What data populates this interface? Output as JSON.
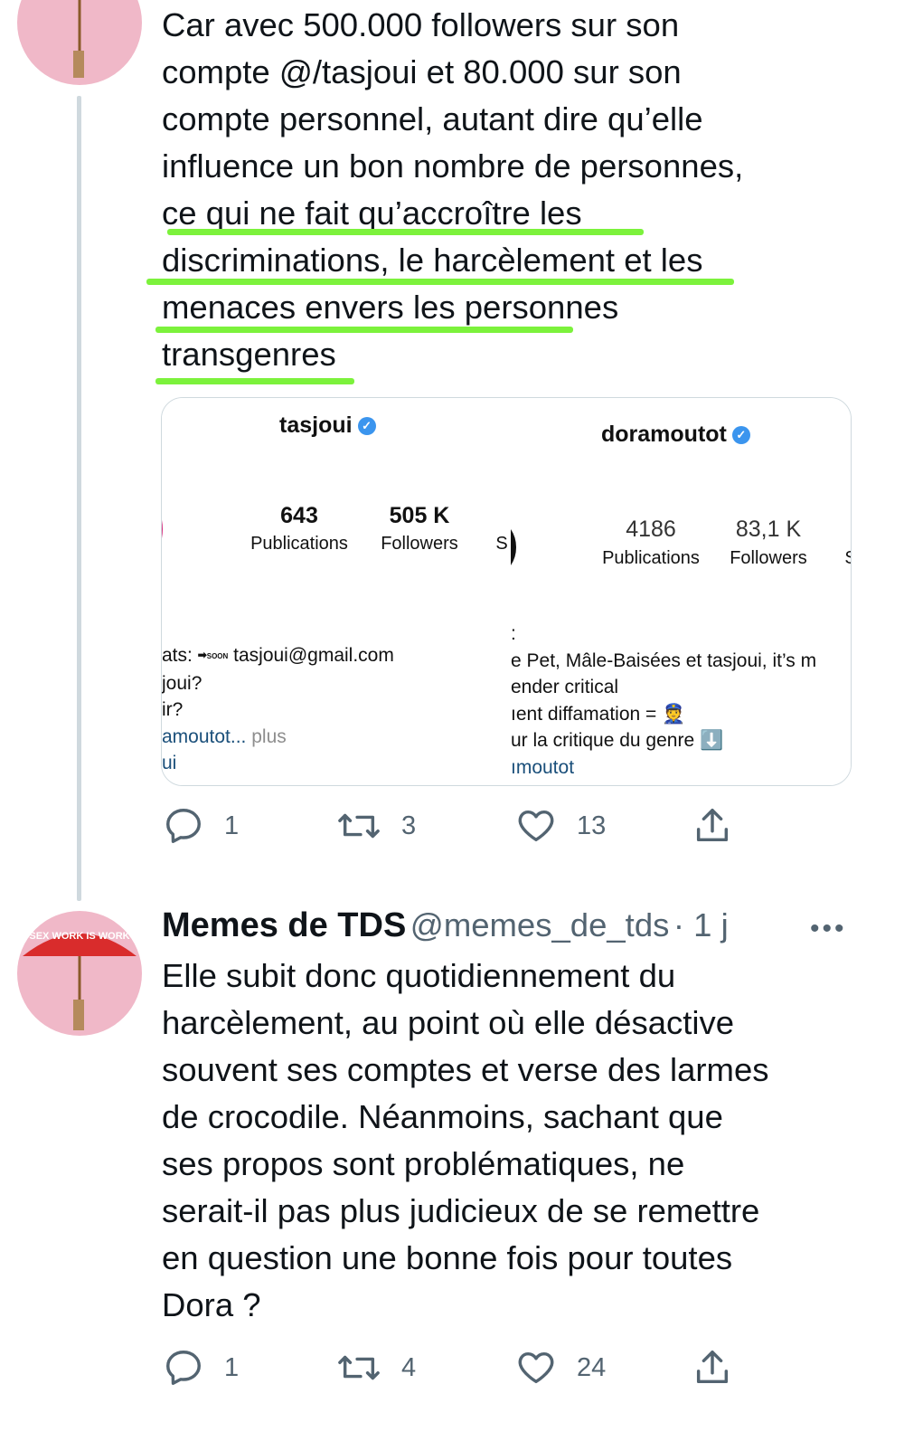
{
  "tweet1": {
    "lines": [
      "Car avec 500.000 followers sur son",
      "compte @/tasjoui et 80.000 sur son",
      "compte personnel, autant dire qu’elle",
      "influence un bon nombre de personnes,",
      "ce qui ne fait qu’accroître les",
      "discriminations, le harcèlement et les",
      "menaces envers les personnes",
      "transgenres"
    ],
    "card": {
      "left": {
        "username": "tasjoui",
        "stats": [
          {
            "value": "643",
            "label": "Publications"
          },
          {
            "value": "505 K",
            "label": "Followers"
          }
        ],
        "stat_cut": "S",
        "bio": [
          {
            "text": "ats: ➡ tasjoui@gmail.com",
            "style": "normal"
          },
          {
            "text": "joui?",
            "style": "normal"
          },
          {
            "text": "ir?",
            "style": "normal"
          },
          {
            "text": "amoutot...",
            "style": "link",
            "suffix": " plus"
          },
          {
            "text": "ui",
            "style": "link"
          }
        ],
        "soon_badge": "SOON"
      },
      "right": {
        "username": "doramoutot",
        "stats": [
          {
            "value": "4186",
            "label": "Publications"
          },
          {
            "value": "83,1 K",
            "label": "Followers"
          }
        ],
        "stat_cut": "S",
        "bio": [
          {
            "text": ":",
            "style": "normal"
          },
          {
            "text": "e Pet, Mâle-Baisées et tasjoui, it’s m",
            "style": "normal"
          },
          {
            "text": "ender critical",
            "style": "normal"
          },
          {
            "text": "ıent diffamation = 👮",
            "style": "normal"
          },
          {
            "text": "ur la critique du genre ⬇️",
            "style": "normal"
          },
          {
            "text": "ımoutot",
            "style": "link"
          }
        ]
      }
    },
    "actions": {
      "replies": "1",
      "retweets": "3",
      "likes": "13"
    }
  },
  "tweet2": {
    "author_name": "Memes de TDS",
    "author_handle": "@memes_de_tds",
    "time": "· 1 j",
    "more": "•••",
    "avatar_text": "SEX WORK IS WORK",
    "lines": [
      "Elle subit donc quotidiennement du",
      "harcèlement, au point où elle désactive",
      "souvent ses comptes et verse des larmes",
      "de crocodile. Néanmoins, sachant que",
      "ses propos sont problématiques, ne",
      "serait-il pas plus judicieux de se remettre",
      "en question une bonne fois pour toutes",
      "Dora ?"
    ],
    "actions": {
      "replies": "1",
      "retweets": "4",
      "likes": "24"
    }
  },
  "colors": {
    "underline": "#7cf23c",
    "avatar_bg": "#f0b8c8",
    "umbrella": "#d92c2c",
    "verified": "#3b95ee",
    "muted": "#536471"
  }
}
